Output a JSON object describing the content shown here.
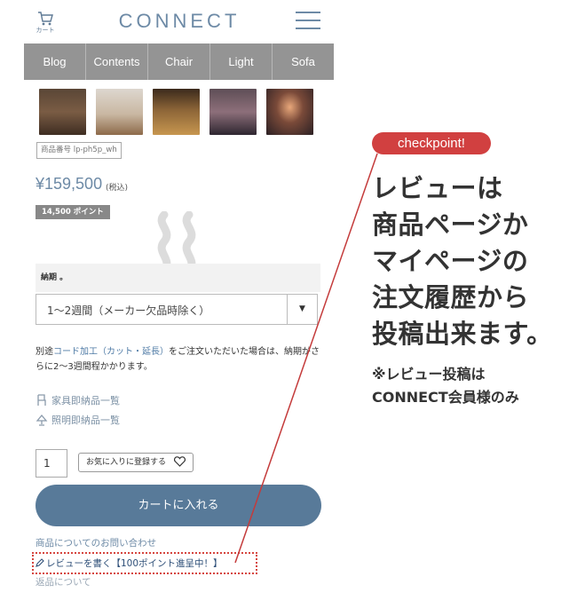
{
  "header": {
    "cart_label": "カート",
    "brand": "CONNECT"
  },
  "nav": {
    "items": [
      "Blog",
      "Contents",
      "Chair",
      "Light",
      "Sofa"
    ]
  },
  "product": {
    "sku": "商品番号 lp-ph5p_wh",
    "price": "¥159,500",
    "tax": "(税込)",
    "points": "14,500 ポイント"
  },
  "delivery": {
    "label": "納期 。",
    "selected": "1〜2週間（メーカー欠品時除く）"
  },
  "note": {
    "prefix": "別途",
    "link": "コード加工（カット・延長）",
    "suffix": "をご注文いただいた場合は、納期がさらに2〜3週間程かかります。"
  },
  "links": {
    "furniture": "家具即納品一覧",
    "lighting": "照明即納品一覧"
  },
  "purchase": {
    "quantity": "1",
    "favorite": "お気に入りに登録する",
    "add_to_cart": "カートに入れる"
  },
  "footer_links": {
    "inquiry": "商品についてのお問い合わせ",
    "review": "レビューを書く【100ポイント進呈中！】",
    "returns": "返品について"
  },
  "annotation": {
    "badge": "checkpoint!",
    "headline_lines": [
      "レビューは",
      "商品ページか",
      "マイページの",
      "注文履歴から",
      "投稿出来ます。"
    ],
    "sub_lines": [
      "※レビュー投稿は",
      "CONNECT会員様のみ"
    ],
    "accent_color": "#d14040"
  },
  "colors": {
    "brand": "#6d8aa6",
    "nav_bg": "#949494",
    "button": "#587a99"
  }
}
